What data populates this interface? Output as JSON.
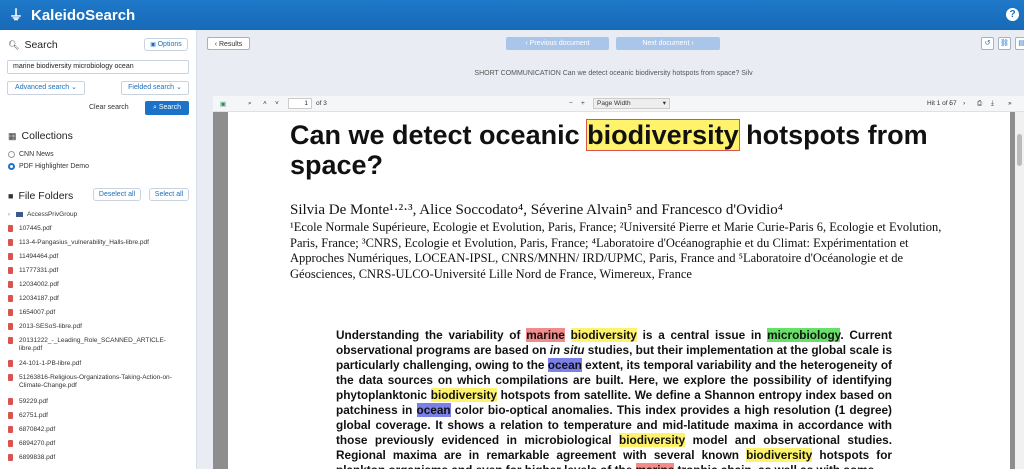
{
  "app": {
    "name": "KaleidoSearch",
    "help": "?"
  },
  "sidebar": {
    "search": {
      "title": "Search",
      "options_label": "Options",
      "query": "marine biodiversity microbiology ocean",
      "advanced_label": "Advanced search",
      "fielded_label": "Fielded search",
      "clear_label": "Clear search",
      "submit_label": "Search"
    },
    "collections": {
      "title": "Collections",
      "items": [
        {
          "label": "CNN News",
          "selected": false
        },
        {
          "label": "PDF Highlighter Demo",
          "selected": true
        }
      ]
    },
    "folders": {
      "title": "File Folders",
      "deselect_label": "Deselect all",
      "select_label": "Select all",
      "items": [
        "AccessPrivGroup",
        "107445.pdf",
        "113-4-Pangasius_vulnerability_Halls-libre.pdf",
        "11494464.pdf",
        "11777331.pdf",
        "12034002.pdf",
        "12034187.pdf",
        "1654007.pdf",
        "2013-SESoS-libre.pdf",
        "20131222_-_Leading_Role_SCANNED_ARTICLE-",
        "libre.pdf",
        "24-101-1-PB-libre.pdf",
        "51263816-Religious-Organizations-Taking-Action-on-",
        "Climate-Change.pdf",
        "59229.pdf",
        "62751.pdf",
        "6870842.pdf",
        "6894270.pdf",
        "6899838.pdf"
      ]
    }
  },
  "toolbar": {
    "results_label": "Results",
    "prev_label": "Previous document",
    "next_label": "Next document"
  },
  "document": {
    "title_line": "SHORT COMMUNICATION Can we detect oceanic biodiversity hotspots from space? Silv",
    "page_input": "1",
    "page_total": "of 3",
    "zoom": "Page Width",
    "hits": "Hit 1 of 57"
  },
  "page": {
    "title": {
      "before": "Can we detect oceanic ",
      "hit": "biodiversity",
      "after": " hotspots from space?"
    },
    "authors": "Silvia De Monte¹·²·³, Alice Soccodato⁴, Séverine Alvain⁵ and Francesco d'Ovidio⁴",
    "affiliations": "¹Ecole Normale Supérieure, Ecologie et Evolution, Paris, France; ²Université Pierre et Marie Curie-Paris 6, Ecologie et Evolution, Paris, France; ³CNRS, Ecologie et Evolution, Paris, France; ⁴Laboratoire d'Océanographie et du Climat: Expérimentation et Approches Numériques, LOCEAN-IPSL, CNRS/MNHN/ IRD/UPMC, Paris, France and ⁵Laboratoire d'Océanologie et de Géosciences, CNRS-ULCO-Université Lille Nord de France, Wimereux, France",
    "abstract": [
      {
        "t": "Understanding the variability of ",
        "h": ""
      },
      {
        "t": "marine",
        "h": "r"
      },
      {
        "t": " ",
        "h": ""
      },
      {
        "t": "biodiversity",
        "h": "y"
      },
      {
        "t": " is a central issue in ",
        "h": ""
      },
      {
        "t": "microbiology",
        "h": "g"
      },
      {
        "t": ". Current observational programs are based on ",
        "h": ""
      },
      {
        "t": "in situ",
        "h": "i"
      },
      {
        "t": " studies, but their implementation at the global scale is particularly challenging, owing to the ",
        "h": ""
      },
      {
        "t": "ocean",
        "h": "b"
      },
      {
        "t": " extent, its temporal variability and the heterogeneity of the data sources on which compilations are built. Here, we explore the possibility of identifying phytoplanktonic ",
        "h": ""
      },
      {
        "t": "biodiversity",
        "h": "y"
      },
      {
        "t": " hotspots from satellite. We define a Shannon entropy index based on patchiness in ",
        "h": ""
      },
      {
        "t": "ocean",
        "h": "b"
      },
      {
        "t": " color bio-optical anomalies. This index provides a high resolution (1 degree) global coverage. It shows a relation to temperature and mid-latitude maxima in accordance with those previously evidenced in microbiological ",
        "h": ""
      },
      {
        "t": "biodiversity",
        "h": "y"
      },
      {
        "t": " model and observational studies. Regional maxima are in remarkable agreement with several known ",
        "h": ""
      },
      {
        "t": "biodiversity",
        "h": "y"
      },
      {
        "t": " hotspots for plankton organisms and even for higher levels of the ",
        "h": ""
      },
      {
        "t": "marine",
        "h": "r"
      },
      {
        "t": " trophic chain, as well as with some",
        "h": ""
      }
    ]
  },
  "colors": {
    "topbar": "#1a73c8",
    "highlight_biodiversity": "#fff36b",
    "highlight_marine": "#f28b8b",
    "highlight_microbiology": "#67e067",
    "highlight_ocean": "#7b7fe8"
  }
}
